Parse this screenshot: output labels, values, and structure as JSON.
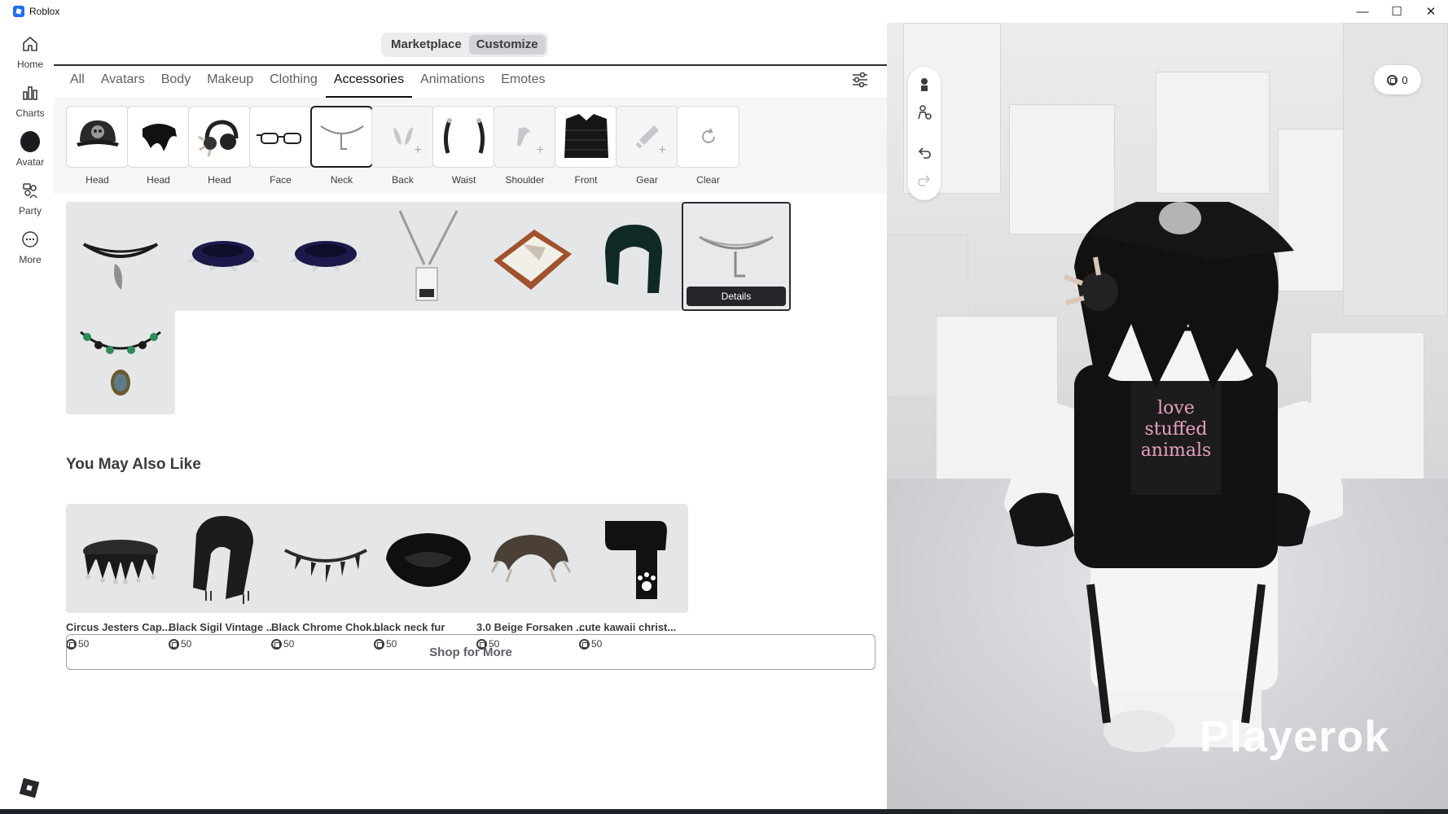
{
  "window": {
    "title": "Roblox",
    "controls": [
      "—",
      "☐",
      "✕"
    ]
  },
  "sidebar": {
    "items": [
      {
        "label": "Home",
        "icon": "home-icon"
      },
      {
        "label": "Charts",
        "icon": "charts-icon"
      },
      {
        "label": "Avatar",
        "icon": "avatar-icon"
      },
      {
        "label": "Party",
        "icon": "party-icon"
      },
      {
        "label": "More",
        "icon": "more-icon"
      }
    ]
  },
  "segment": {
    "marketplace": "Marketplace",
    "customize": "Customize",
    "selected": "Customize"
  },
  "tabs": [
    "All",
    "Avatars",
    "Body",
    "Makeup",
    "Clothing",
    "Accessories",
    "Animations",
    "Emotes"
  ],
  "active_tab": "Accessories",
  "slots": [
    {
      "label": "Head",
      "state": "filled"
    },
    {
      "label": "Head",
      "state": "filled"
    },
    {
      "label": "Head",
      "state": "filled"
    },
    {
      "label": "Face",
      "state": "filled"
    },
    {
      "label": "Neck",
      "state": "selected"
    },
    {
      "label": "Back",
      "state": "empty"
    },
    {
      "label": "Waist",
      "state": "filled"
    },
    {
      "label": "Shoulder",
      "state": "empty"
    },
    {
      "label": "Front",
      "state": "filled"
    },
    {
      "label": "Gear",
      "state": "empty"
    },
    {
      "label": "Clear",
      "state": "action"
    }
  ],
  "inventory": {
    "details_label": "Details",
    "selected_index": 6
  },
  "recommendations": {
    "title": "You May Also Like",
    "items": [
      {
        "name": "Circus Jesters Cap...",
        "price": "50"
      },
      {
        "name": "Black Sigil Vintage ...",
        "price": "50"
      },
      {
        "name": "Black Chrome Chok...",
        "price": "50"
      },
      {
        "name": "black neck fur",
        "price": "50"
      },
      {
        "name": "3.0 Beige Forsaken ...",
        "price": "50"
      },
      {
        "name": "cute kawaii christ...",
        "price": "50"
      }
    ],
    "shop_button": "Shop for More"
  },
  "scene": {
    "robux_balance": "0",
    "watermark": "Playerok"
  }
}
